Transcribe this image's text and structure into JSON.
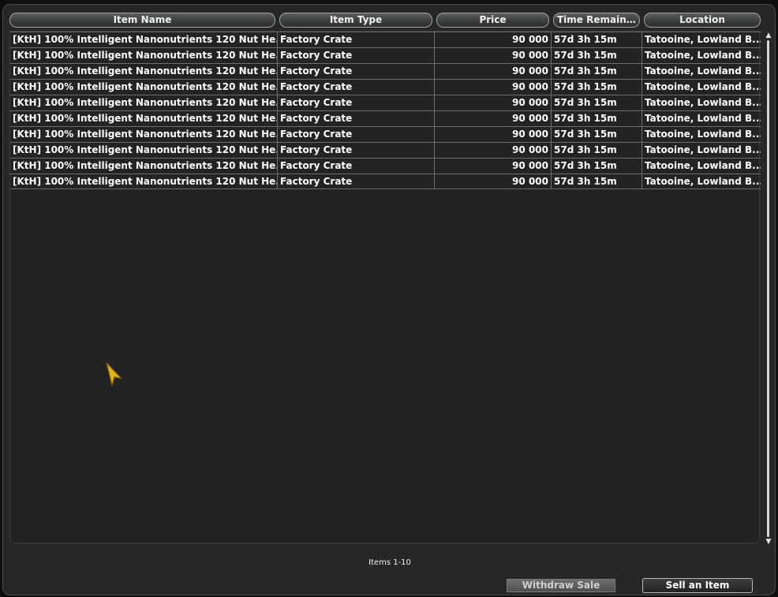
{
  "columns": [
    {
      "label": "Item Name"
    },
    {
      "label": "Item Type"
    },
    {
      "label": "Price"
    },
    {
      "label": "Time Remaini..."
    },
    {
      "label": "Location"
    }
  ],
  "rows": [
    {
      "name": "[KtH] 100% Intelligent Nanonutrients 120 Nut He...",
      "type": "Factory Crate",
      "price": "90 000",
      "time": "57d 3h 15m",
      "location": "Tatooine, Lowland B..."
    },
    {
      "name": "[KtH] 100% Intelligent Nanonutrients 120 Nut He...",
      "type": "Factory Crate",
      "price": "90 000",
      "time": "57d 3h 15m",
      "location": "Tatooine, Lowland B..."
    },
    {
      "name": "[KtH] 100% Intelligent Nanonutrients 120 Nut He...",
      "type": "Factory Crate",
      "price": "90 000",
      "time": "57d 3h 15m",
      "location": "Tatooine, Lowland B..."
    },
    {
      "name": "[KtH] 100% Intelligent Nanonutrients 120 Nut He...",
      "type": "Factory Crate",
      "price": "90 000",
      "time": "57d 3h 15m",
      "location": "Tatooine, Lowland B..."
    },
    {
      "name": "[KtH] 100% Intelligent Nanonutrients 120 Nut He...",
      "type": "Factory Crate",
      "price": "90 000",
      "time": "57d 3h 15m",
      "location": "Tatooine, Lowland B..."
    },
    {
      "name": "[KtH] 100% Intelligent Nanonutrients 120 Nut He...",
      "type": "Factory Crate",
      "price": "90 000",
      "time": "57d 3h 15m",
      "location": "Tatooine, Lowland B..."
    },
    {
      "name": "[KtH] 100% Intelligent Nanonutrients 120 Nut He...",
      "type": "Factory Crate",
      "price": "90 000",
      "time": "57d 3h 15m",
      "location": "Tatooine, Lowland B..."
    },
    {
      "name": "[KtH] 100% Intelligent Nanonutrients 120 Nut He...",
      "type": "Factory Crate",
      "price": "90 000",
      "time": "57d 3h 15m",
      "location": "Tatooine, Lowland B..."
    },
    {
      "name": "[KtH] 100% Intelligent Nanonutrients 120 Nut He...",
      "type": "Factory Crate",
      "price": "90 000",
      "time": "57d 3h 15m",
      "location": "Tatooine, Lowland B..."
    },
    {
      "name": "[KtH] 100% Intelligent Nanonutrients 120 Nut He...",
      "type": "Factory Crate",
      "price": "90 000",
      "time": "57d 3h 15m",
      "location": "Tatooine, Lowland B..."
    }
  ],
  "footer": {
    "items_count": "Items 1-10",
    "withdraw_label": "Withdraw Sale",
    "sell_label": "Sell an Item"
  },
  "scrollbar": {
    "up_glyph": "▲",
    "down_glyph": "▼"
  },
  "colors": {
    "cursor": "#e2b21a"
  }
}
